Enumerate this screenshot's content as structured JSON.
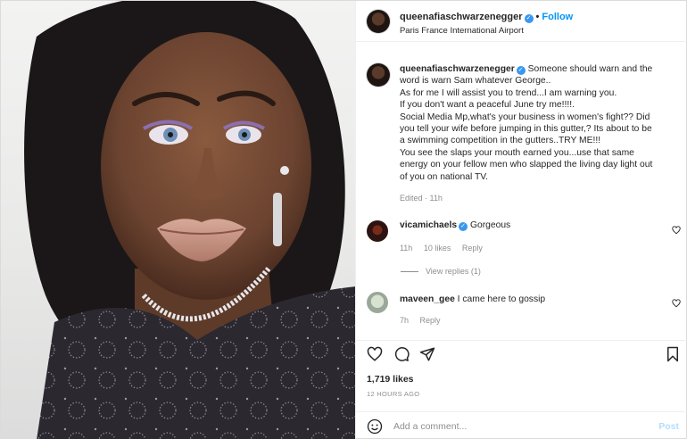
{
  "header": {
    "username": "queenafiaschwarzenegger",
    "dot": "•",
    "follow_label": "Follow",
    "location": "Paris France International Airport"
  },
  "caption": {
    "username": "queenafiaschwarzenegger",
    "lines": [
      "Someone should warn and the",
      "word is warn Sam whatever George..",
      "As for me I will assist you to trend...I am warning you.",
      "If you don't want a peaceful June try me!!!!.",
      "Social Media Mp,what's your business in women's fight?? Did",
      "you tell your wife before jumping in this gutter,? Its about to be",
      "a swimming competition in the gutters..TRY ME!!!",
      "You see the slaps your mouth earned you...use that same",
      "energy on your fellow men who slapped the living day light out",
      "of you on national TV."
    ],
    "meta": "Edited · 11h"
  },
  "comments": [
    {
      "username": "vicamichaels",
      "verified": true,
      "text": "Gorgeous",
      "time": "11h",
      "likes": "10 likes",
      "reply_label": "Reply",
      "view_replies": "View replies (1)"
    },
    {
      "username": "maveen_gee",
      "verified": false,
      "text": "I came here to gossip",
      "time": "7h",
      "reply_label": "Reply"
    }
  ],
  "post": {
    "likes": "1,719 likes",
    "timestamp": "12 HOURS AGO"
  },
  "add_comment": {
    "placeholder": "Add a comment...",
    "post_label": "Post"
  },
  "icons": {
    "like": "heart-icon",
    "comment": "comment-icon",
    "share": "share-icon",
    "save": "bookmark-icon",
    "emoji": "emoji-icon",
    "verified": "verified-badge-icon"
  },
  "colors": {
    "accent": "#0095f6",
    "verified": "#3897f0",
    "muted": "#8e8e8e",
    "post_disabled": "#b2dffc"
  }
}
